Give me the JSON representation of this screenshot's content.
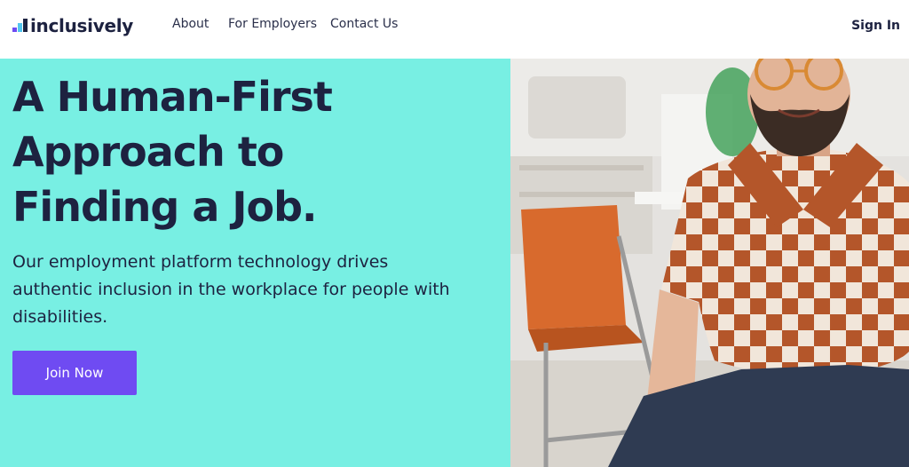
{
  "nav": {
    "logo_text": "inclusively",
    "links": [
      "About",
      "For Employers",
      "Contact Us"
    ],
    "sign_in": "Sign In"
  },
  "hero": {
    "headline": [
      "A Human-First",
      "Approach to",
      "Finding a Job."
    ],
    "subheadline": "Our employment platform technology drives authentic inclusion in the workplace for people with disabilities.",
    "cta_label": "Join Now"
  },
  "colors": {
    "hero_background": "#78efe3",
    "accent": "#6f4bf2",
    "text_dark": "#1d2240"
  }
}
